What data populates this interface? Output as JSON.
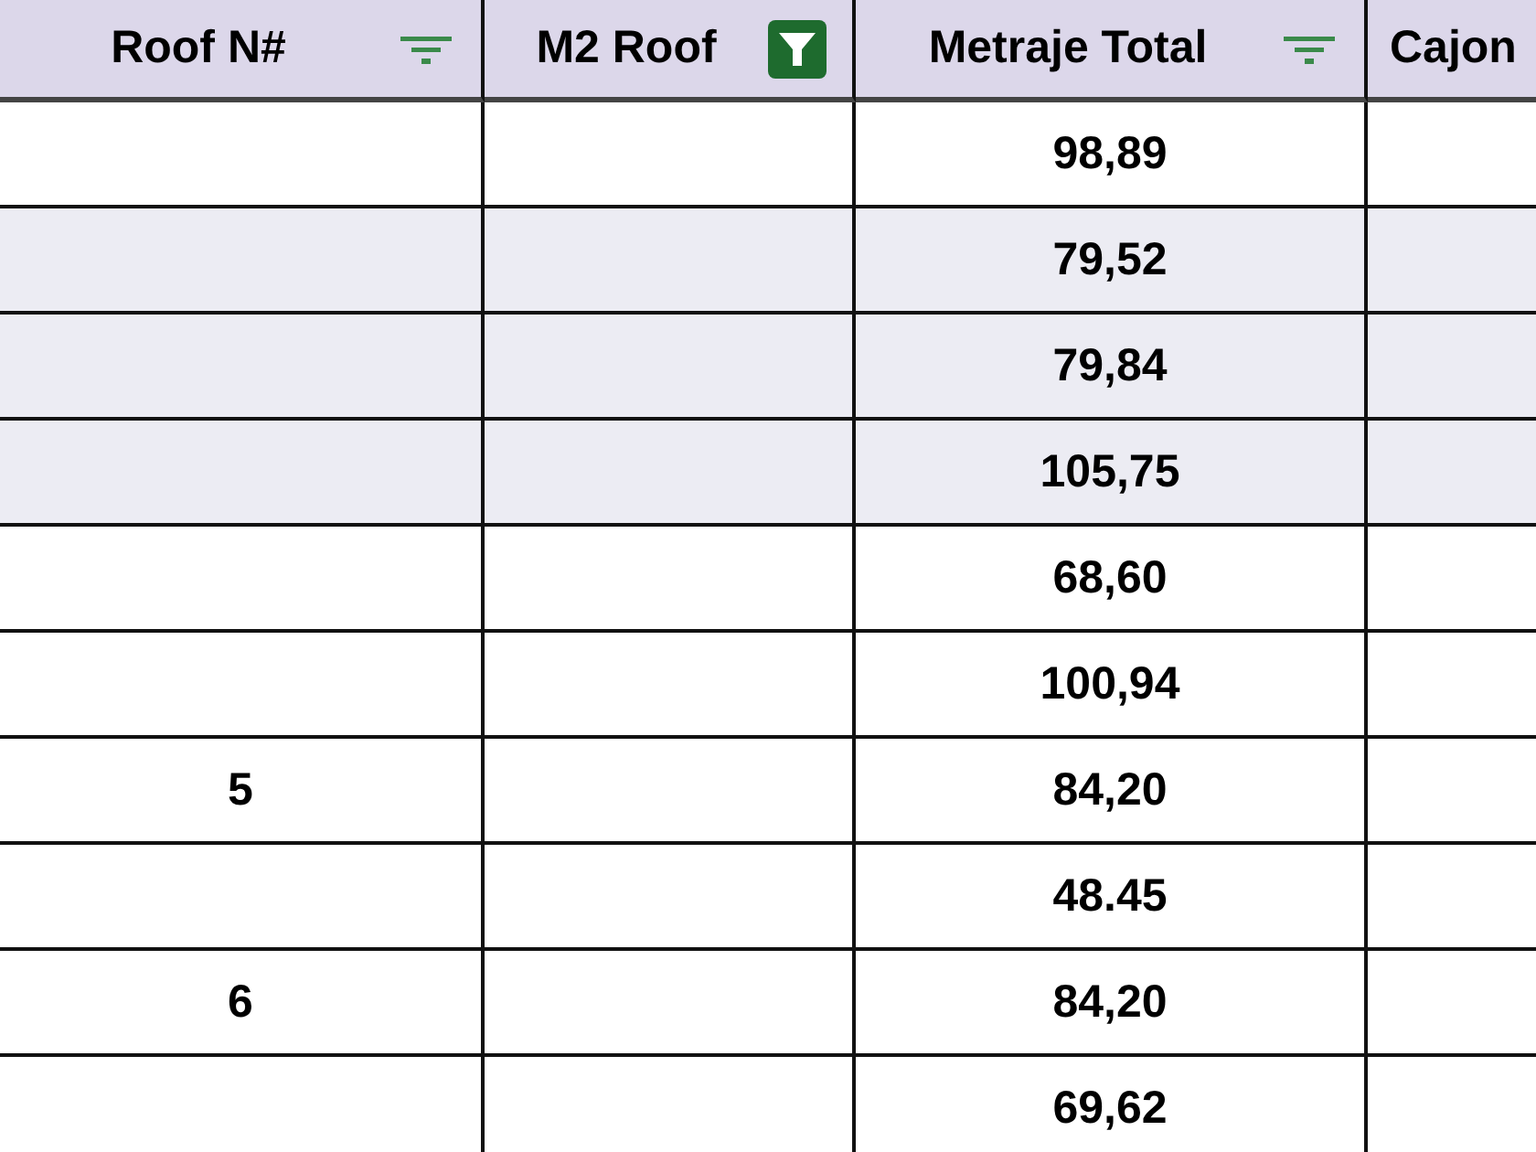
{
  "table": {
    "columns": [
      {
        "label": "Roof N#",
        "filter_active": false
      },
      {
        "label": "M2 Roof",
        "filter_active": true
      },
      {
        "label": "Metraje Total",
        "filter_active": false
      },
      {
        "label": "Cajon"
      }
    ],
    "rows": [
      {
        "roof_n": "",
        "metraje_total": "98,89",
        "shaded": false
      },
      {
        "roof_n": "",
        "metraje_total": "79,52",
        "shaded": true
      },
      {
        "roof_n": "",
        "metraje_total": "79,84",
        "shaded": true
      },
      {
        "roof_n": "",
        "metraje_total": "105,75",
        "shaded": true
      },
      {
        "roof_n": "",
        "metraje_total": "68,60",
        "shaded": false
      },
      {
        "roof_n": "",
        "metraje_total": "100,94",
        "shaded": false
      },
      {
        "roof_n": "5",
        "metraje_total": "84,20",
        "shaded": false
      },
      {
        "roof_n": "",
        "metraje_total": "48.45",
        "shaded": false
      },
      {
        "roof_n": "6",
        "metraje_total": "84,20",
        "shaded": false
      },
      {
        "roof_n": "",
        "metraje_total": "69,62",
        "shaded": false
      }
    ]
  }
}
